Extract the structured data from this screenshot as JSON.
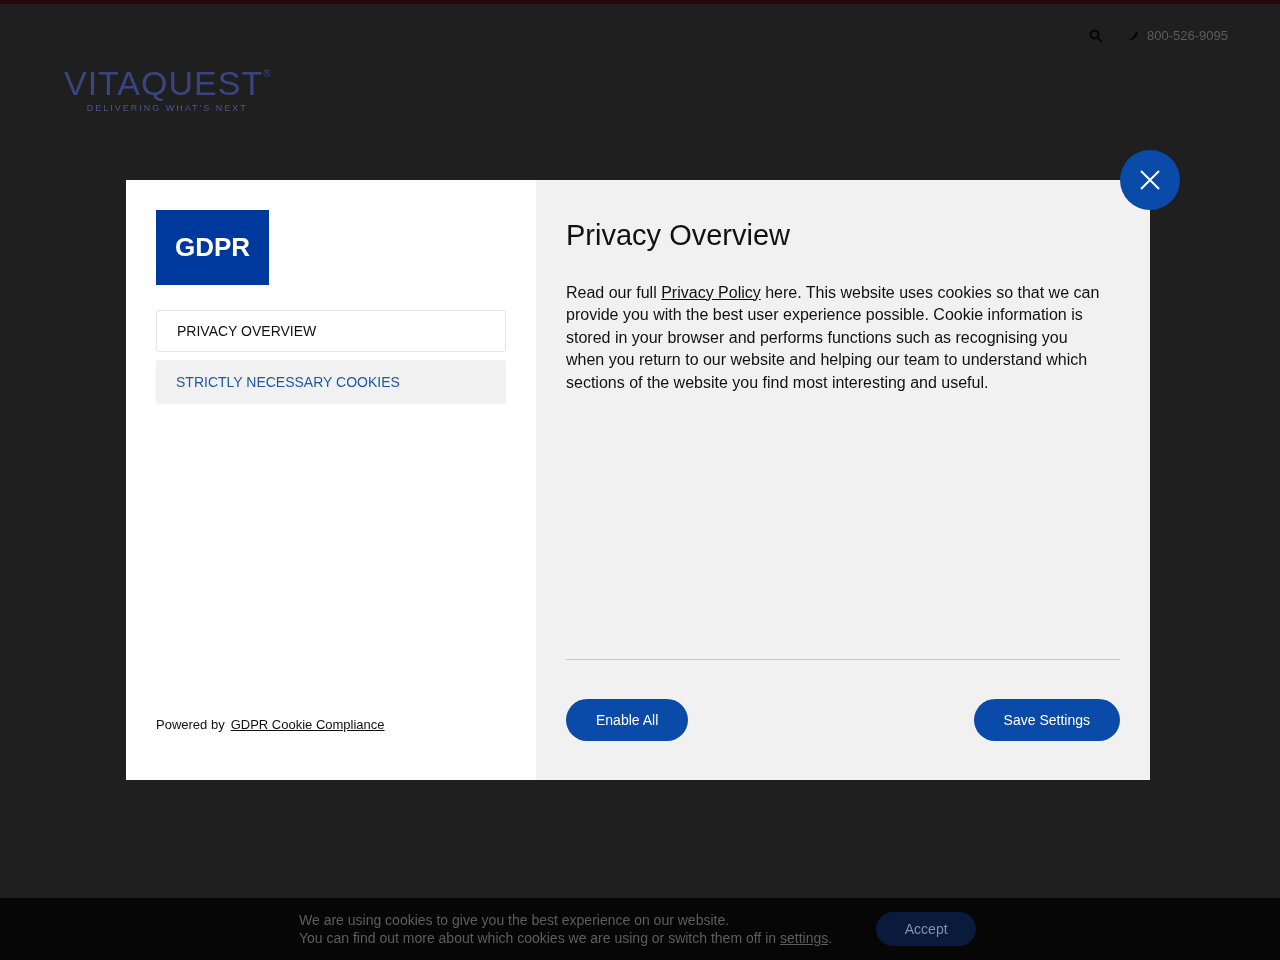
{
  "header": {
    "logo": {
      "name": "VITAQUEST",
      "mark": "®",
      "tagline": "DELIVERING WHAT'S NEXT"
    },
    "phone": "800-526-9095"
  },
  "modal": {
    "badge": "GDPR",
    "tabs": [
      {
        "label": "PRIVACY OVERVIEW",
        "selected": true
      },
      {
        "label": "STRICTLY NECESSARY COOKIES",
        "selected": false
      }
    ],
    "powered_by": {
      "text": "Powered by",
      "link": "GDPR Cookie Compliance"
    },
    "title": "Privacy Overview",
    "description": {
      "before": "Read our full",
      "link": "Privacy Policy",
      "after": "here. This website uses cookies so that we can provide you with the best user experience possible. Cookie information is stored in your browser and performs functions such as recognising you when you return to our website and helping our team to understand which sections of the website you find most interesting and useful."
    },
    "buttons": [
      "Enable All",
      "Save Settings"
    ]
  },
  "cookie_bar": {
    "line1": "We are using cookies to give you the best experience on our website.",
    "line2": "You can find out more about which cookies we are using or switch them off in",
    "link": "settings",
    "after_link": ".",
    "button": "Accept"
  }
}
